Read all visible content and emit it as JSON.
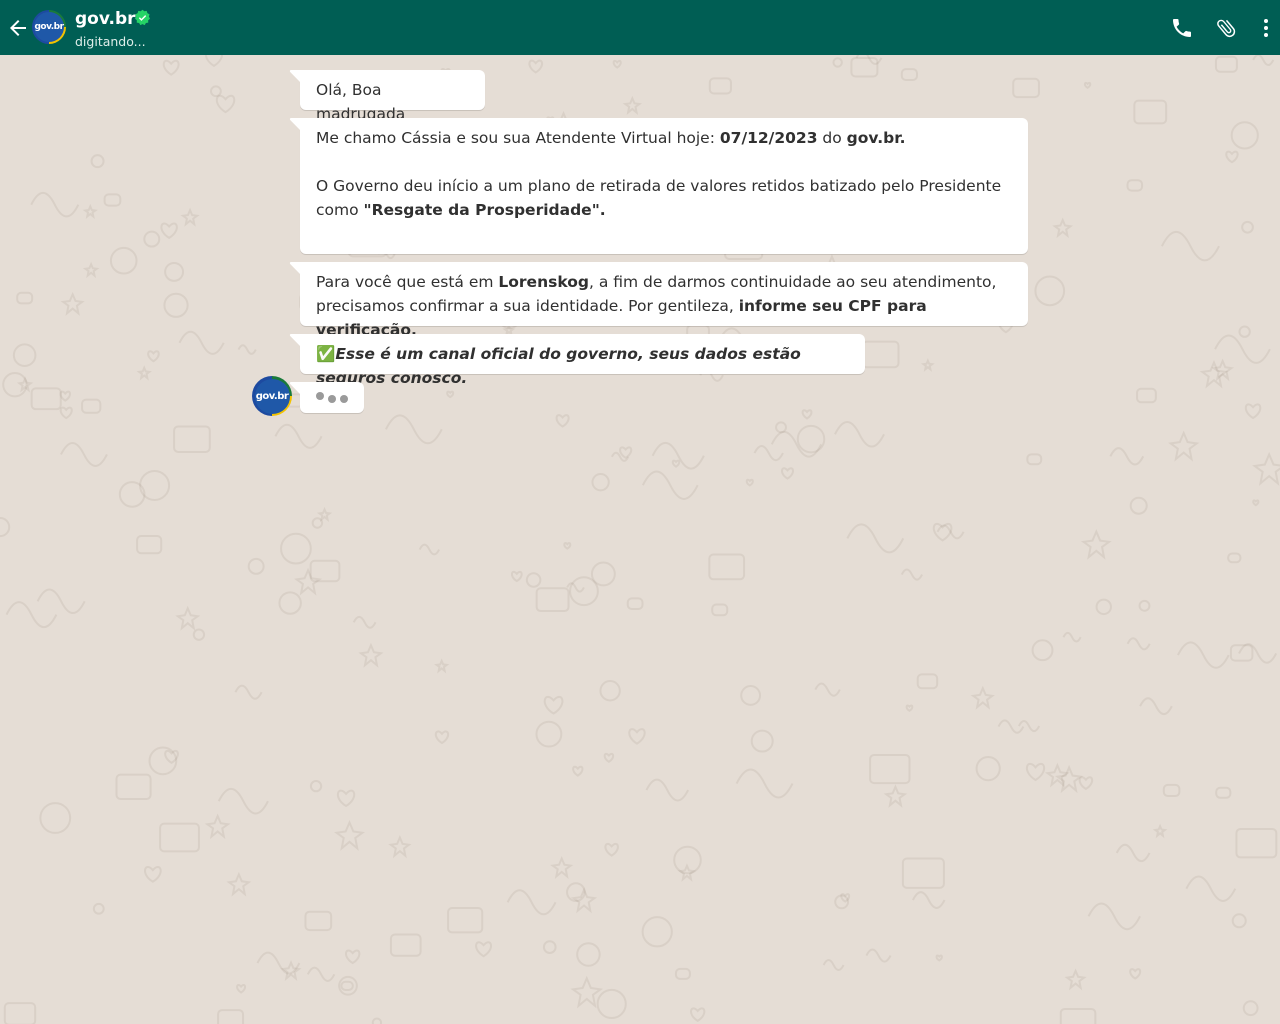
{
  "header": {
    "contact_name": "gov.br",
    "status": "digitando...",
    "avatar_text": "gov.br",
    "icons": [
      "back-arrow-icon",
      "verified-icon",
      "phone-icon",
      "paperclip-icon",
      "more-vertical-icon"
    ]
  },
  "messages": [
    {
      "id": "m1",
      "segments": [
        [
          {
            "t": "Olá, Boa madrugada",
            "b": false
          }
        ]
      ]
    },
    {
      "id": "m2",
      "segments": [
        [
          {
            "t": "Me chamo Cássia e sou sua Atendente Virtual hoje: ",
            "b": false
          },
          {
            "t": "07/12/2023",
            "b": true
          },
          {
            "t": " do ",
            "b": false
          },
          {
            "t": "gov.br.",
            "b": true
          }
        ],
        [],
        [
          {
            "t": "O Governo deu início a um plano de retirada de valores retidos batizado pelo Presidente como  ",
            "b": false
          },
          {
            "t": "\"Resgate da Prosperidade\".",
            "b": true
          }
        ]
      ]
    },
    {
      "id": "m3",
      "segments": [
        [
          {
            "t": "Para você que está em ",
            "b": false
          },
          {
            "t": "Lorenskog",
            "b": true
          },
          {
            "t": ", a fim de darmos continuidade ao seu atendimento, precisamos confirmar a sua identidade. Por gentileza, ",
            "b": false
          },
          {
            "t": "informe seu CPF para verificação.",
            "b": true
          }
        ]
      ]
    },
    {
      "id": "m4",
      "segments": [
        [
          {
            "t": "✅",
            "b": false
          },
          {
            "t": "Esse é um canal oficial do governo, seus dados estão seguros conosco.",
            "b": true,
            "i": true
          }
        ]
      ]
    }
  ],
  "bot_avatar_text": "gov.br",
  "colors": {
    "header_bg": "#005e54",
    "chat_bg": "#e5ddd5",
    "bubble_bg": "#ffffff",
    "verified": "#25d366"
  }
}
